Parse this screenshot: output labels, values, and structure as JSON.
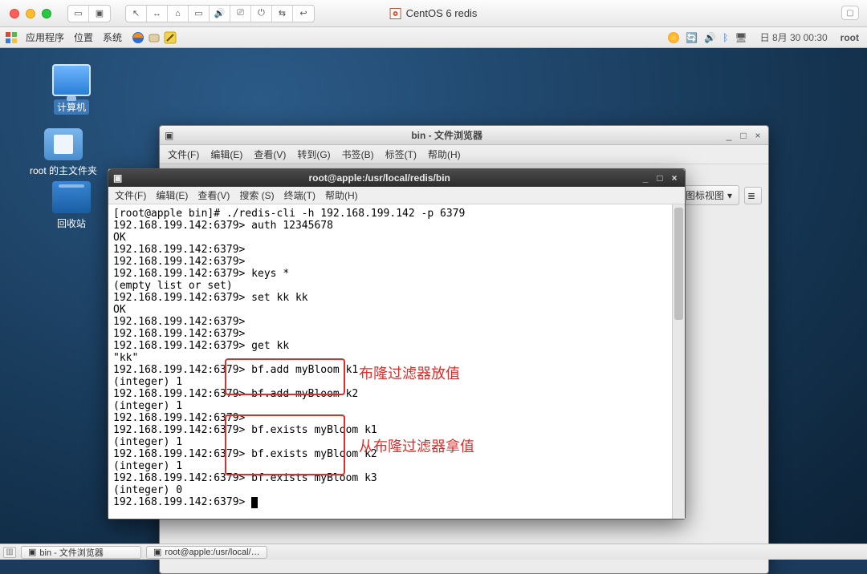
{
  "host": {
    "vm_name": "CentOS 6 redis",
    "toolbar_glyphs": [
      "⎚",
      "⎙",
      "↔",
      "⌂",
      "⎋",
      "⎙",
      "🔊",
      "⎚",
      "⏻",
      "⇆",
      "↩"
    ]
  },
  "gnome": {
    "menus": {
      "applications": "应用程序",
      "places": "位置",
      "system": "系统"
    },
    "clock": "日 8月 30 00:30",
    "user": "root"
  },
  "desktop_icons": {
    "computer": "计算机",
    "home": "root 的主文件夹",
    "trash": "回收站"
  },
  "filebrowser": {
    "title": "bin - 文件浏览器",
    "menus": [
      "文件(F)",
      "编辑(E)",
      "查看(V)",
      "转到(G)",
      "书签(B)",
      "标签(T)",
      "帮助(H)"
    ],
    "view_button": "图标视图",
    "winbtns": {
      "min": "_",
      "max": "□",
      "close": "×"
    }
  },
  "terminal": {
    "title": "root@apple:/usr/local/redis/bin",
    "menus": [
      "文件(F)",
      "编辑(E)",
      "查看(V)",
      "搜索 (S)",
      "终端(T)",
      "帮助(H)"
    ],
    "winbtns": {
      "min": "_",
      "max": "□",
      "close": "×"
    },
    "lines": [
      "[root@apple bin]# ./redis-cli -h 192.168.199.142 -p 6379",
      "192.168.199.142:6379> auth 12345678",
      "OK",
      "192.168.199.142:6379>",
      "192.168.199.142:6379>",
      "192.168.199.142:6379> keys *",
      "(empty list or set)",
      "192.168.199.142:6379> set kk kk",
      "OK",
      "192.168.199.142:6379>",
      "192.168.199.142:6379>",
      "192.168.199.142:6379> get kk",
      "\"kk\"",
      "192.168.199.142:6379> bf.add myBloom k1",
      "(integer) 1",
      "192.168.199.142:6379> bf.add myBloom k2",
      "(integer) 1",
      "192.168.199.142:6379>",
      "192.168.199.142:6379> bf.exists myBloom k1",
      "(integer) 1",
      "192.168.199.142:6379> bf.exists myBloom k2",
      "(integer) 1",
      "192.168.199.142:6379> bf.exists myBloom k3",
      "(integer) 0",
      "192.168.199.142:6379> "
    ]
  },
  "annotations": {
    "put_label": "布隆过滤器放值",
    "get_label": "从布隆过滤器拿值"
  },
  "taskbar": {
    "items": [
      "bin - 文件浏览器",
      "root@apple:/usr/local/…"
    ]
  }
}
